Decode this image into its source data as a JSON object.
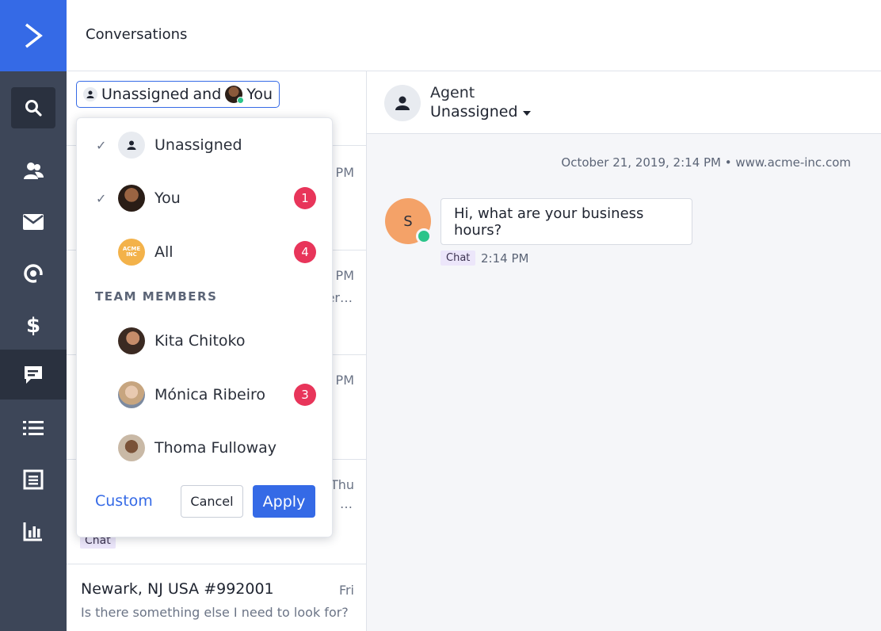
{
  "app": {
    "title": "Conversations",
    "accent": "#356ae6"
  },
  "nav": {
    "icons": [
      "activecampaign-logo-icon",
      "search-icon",
      "contacts-icon",
      "email-icon",
      "automations-icon",
      "deals-icon",
      "conversations-icon",
      "lists-icon",
      "forms-icon",
      "reports-icon"
    ],
    "active": "conversations-icon"
  },
  "filter": {
    "part1": "Unassigned",
    "joiner": "and",
    "part2": "You"
  },
  "dropdown": {
    "items": [
      {
        "label": "Unassigned",
        "checked": true,
        "badge": null
      },
      {
        "label": "You",
        "checked": true,
        "badge": "1"
      },
      {
        "label": "All",
        "checked": false,
        "badge": "4",
        "avatar_text": "ACME INC"
      }
    ],
    "section_title": "TEAM MEMBERS",
    "members": [
      {
        "label": "Kita Chitoko",
        "badge": null
      },
      {
        "label": "Mónica Ribeiro",
        "badge": "3"
      },
      {
        "label": "Thoma Fulloway",
        "badge": null
      }
    ],
    "custom_label": "Custom",
    "cancel_label": "Cancel",
    "apply_label": "Apply"
  },
  "list": {
    "peek": [
      {
        "time": "PM",
        "snippet": ""
      },
      {
        "time": "PM",
        "snippet": "er…"
      },
      {
        "time": "PM",
        "snippet": ""
      },
      {
        "time": "Thu",
        "snippet": "…"
      }
    ],
    "chat_tag": "Chat",
    "last_row": {
      "title": "Newark, NJ USA #992001",
      "time": "Fri",
      "message": "Is there something else I need to look for?"
    }
  },
  "pane": {
    "agent_label": "Agent",
    "agent_value": "Unassigned",
    "meta": "October 21, 2019, 2:14 PM • www.acme-inc.com",
    "customer_initial": "S",
    "message": "Hi, what are your business hours?",
    "message_tag": "Chat",
    "message_time": "2:14 PM"
  }
}
